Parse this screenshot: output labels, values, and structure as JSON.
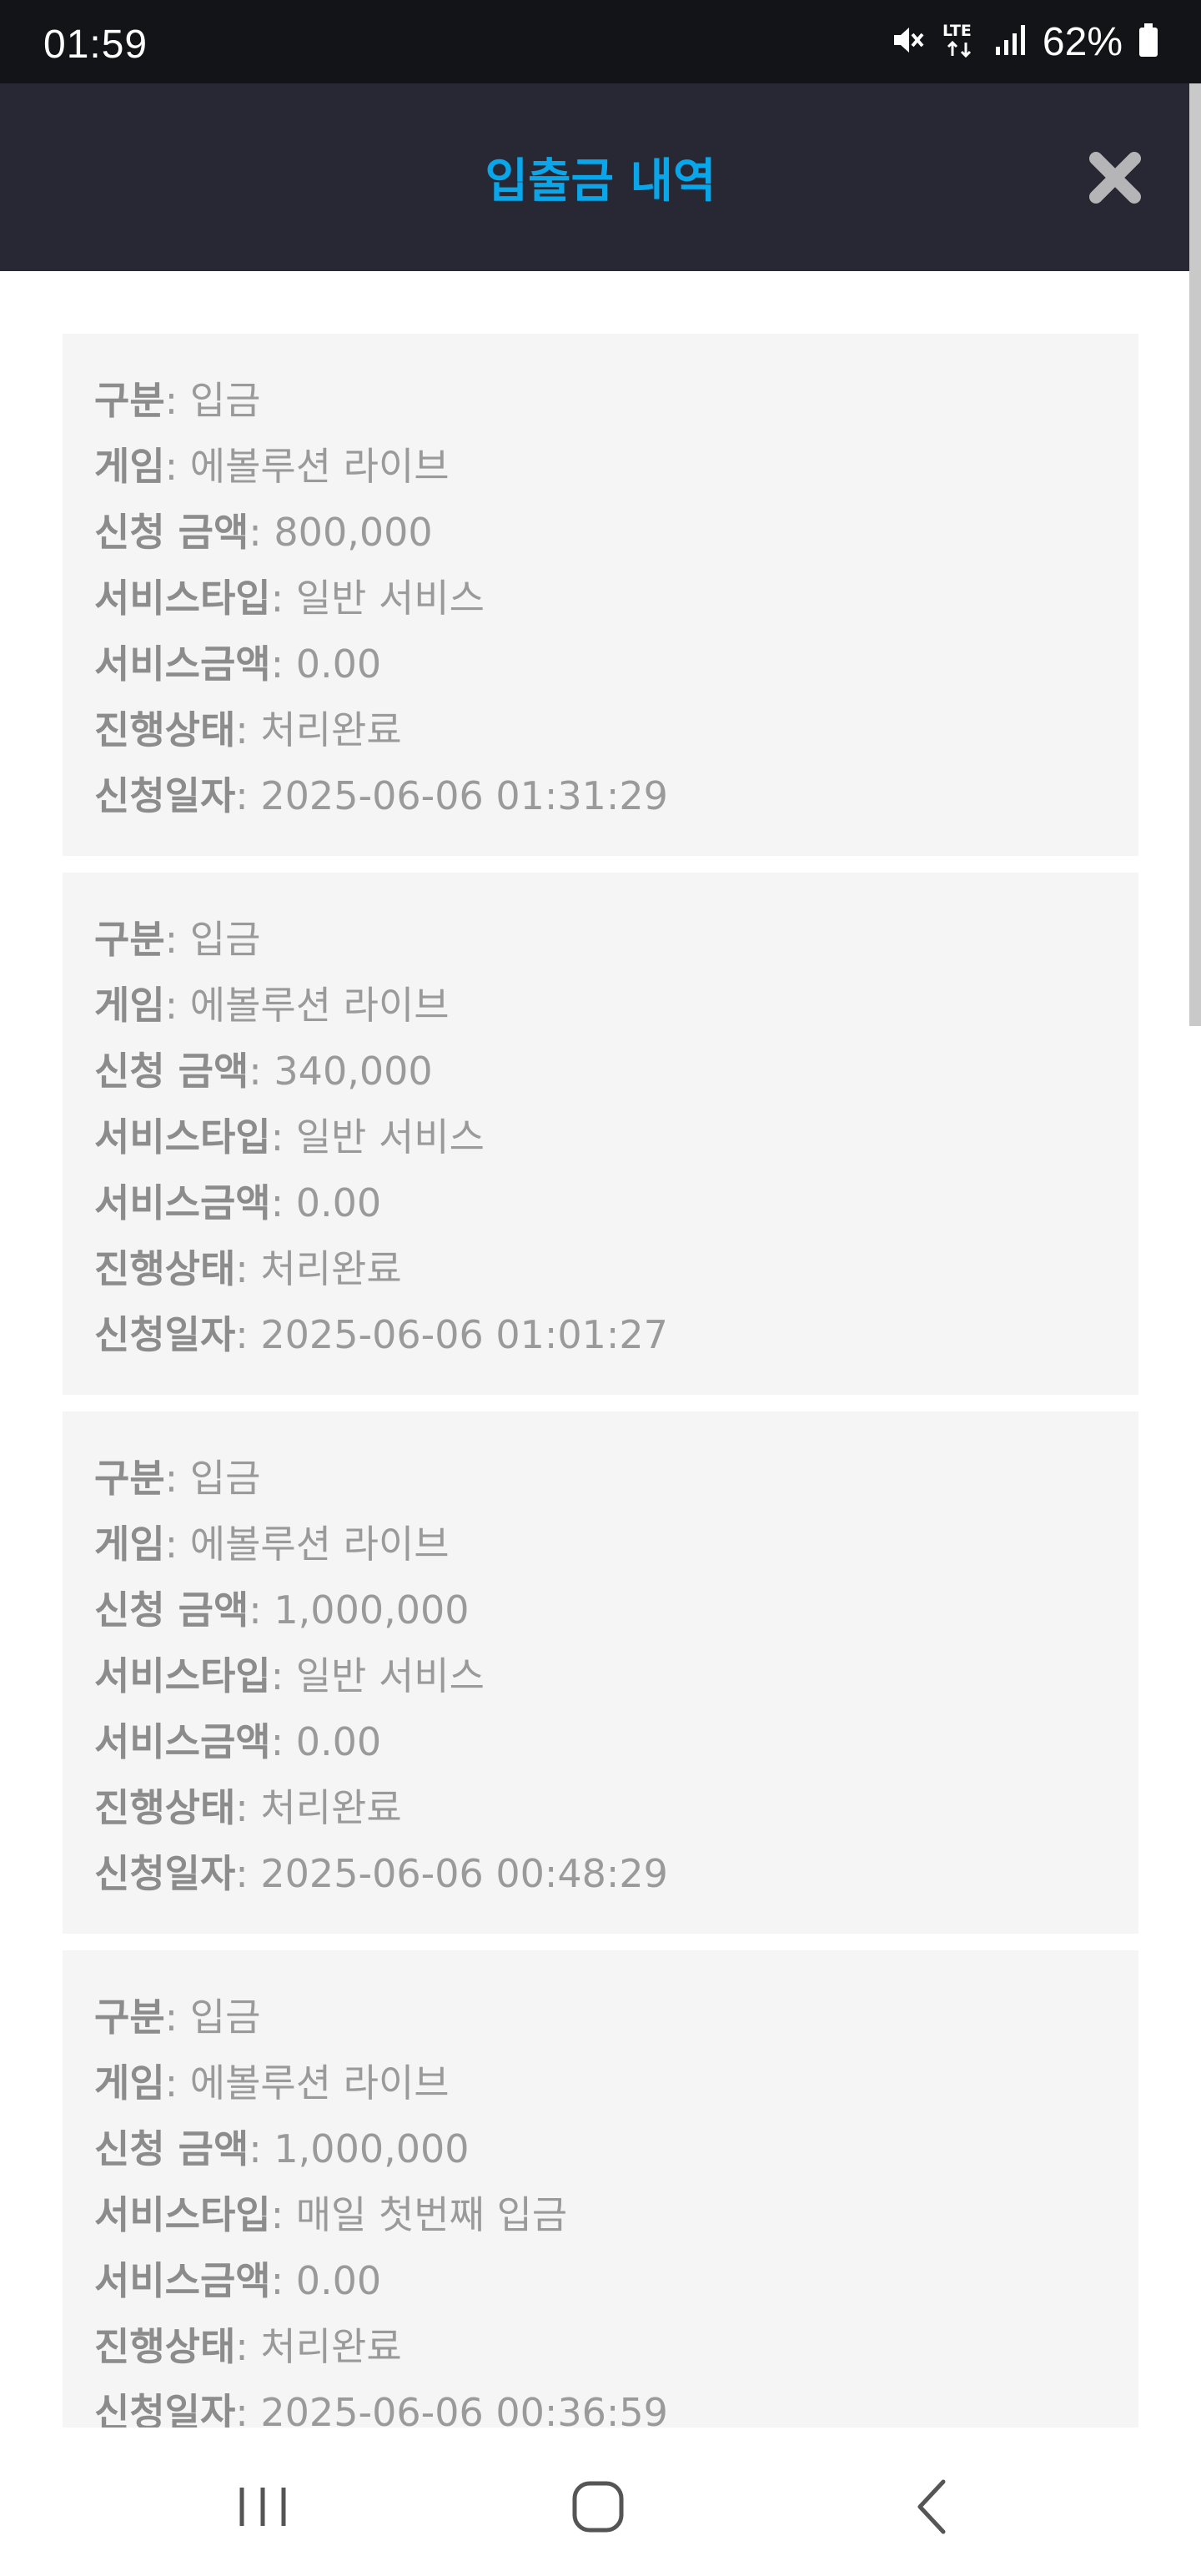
{
  "status_bar": {
    "time": "01:59",
    "battery_percent": "62%",
    "network": "LTE"
  },
  "header": {
    "title": "입출금 내역",
    "close_icon": "close-icon"
  },
  "labels": {
    "type": "구분",
    "game": "게임",
    "amount": "신청 금액",
    "service_type": "서비스타입",
    "service_amount": "서비스금액",
    "status": "진행상태",
    "date": "신청일자"
  },
  "records": [
    {
      "type": ": 입금",
      "game": ": 에볼루션 라이브",
      "amount": ": 800,000",
      "service_type": ": 일반 서비스",
      "service_amount": ": 0.00",
      "status": ": 처리완료",
      "date": ": 2025-06-06 01:31:29"
    },
    {
      "type": ": 입금",
      "game": ": 에볼루션 라이브",
      "amount": ": 340,000",
      "service_type": ": 일반 서비스",
      "service_amount": ": 0.00",
      "status": ": 처리완료",
      "date": ": 2025-06-06 01:01:27"
    },
    {
      "type": ": 입금",
      "game": ": 에볼루션 라이브",
      "amount": ": 1,000,000",
      "service_type": ": 일반 서비스",
      "service_amount": ": 0.00",
      "status": ": 처리완료",
      "date": ": 2025-06-06 00:48:29"
    },
    {
      "type": ": 입금",
      "game": ": 에볼루션 라이브",
      "amount": ": 1,000,000",
      "service_type": ": 매일 첫번째 입금",
      "service_amount": ": 0.00",
      "status": ": 처리완료",
      "date": ": 2025-06-06 00:36:59"
    }
  ],
  "nav_bar": {
    "recents_icon": "recents-icon",
    "home_icon": "home-icon",
    "back_icon": "back-icon"
  },
  "colors": {
    "title": "#0aa6ea",
    "header_bg": "#272834",
    "record_bg": "#f5f5f5",
    "text": "#9a9a9a"
  }
}
